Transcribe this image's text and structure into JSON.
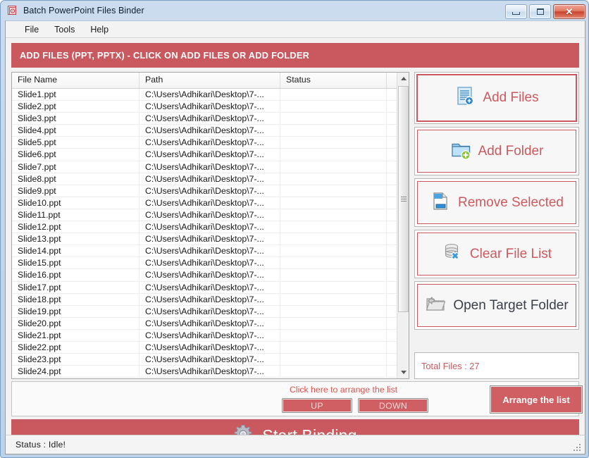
{
  "window": {
    "title": "Batch PowerPoint Files Binder",
    "icon": "app-document-icon",
    "controls": {
      "minimize": "minimize-icon",
      "maximize": "maximize-icon",
      "close": "✕"
    }
  },
  "menu": {
    "items": [
      {
        "label": "File"
      },
      {
        "label": "Tools"
      },
      {
        "label": "Help"
      }
    ]
  },
  "banner": {
    "text": "ADD FILES (PPT, PPTX) - CLICK ON ADD FILES OR ADD FOLDER",
    "background": "#c9585f",
    "color": "#ffffff"
  },
  "file_list": {
    "columns": [
      {
        "label": "File Name"
      },
      {
        "label": "Path"
      },
      {
        "label": "Status"
      },
      {
        "label": ""
      }
    ],
    "rows": [
      {
        "name": "Slide1.ppt",
        "path": "C:\\Users\\Adhikari\\Desktop\\7-...",
        "status": ""
      },
      {
        "name": "Slide2.ppt",
        "path": "C:\\Users\\Adhikari\\Desktop\\7-...",
        "status": ""
      },
      {
        "name": "Slide3.ppt",
        "path": "C:\\Users\\Adhikari\\Desktop\\7-...",
        "status": ""
      },
      {
        "name": "Slide4.ppt",
        "path": "C:\\Users\\Adhikari\\Desktop\\7-...",
        "status": ""
      },
      {
        "name": "Slide5.ppt",
        "path": "C:\\Users\\Adhikari\\Desktop\\7-...",
        "status": ""
      },
      {
        "name": "Slide6.ppt",
        "path": "C:\\Users\\Adhikari\\Desktop\\7-...",
        "status": ""
      },
      {
        "name": "Slide7.ppt",
        "path": "C:\\Users\\Adhikari\\Desktop\\7-...",
        "status": ""
      },
      {
        "name": "Slide8.ppt",
        "path": "C:\\Users\\Adhikari\\Desktop\\7-...",
        "status": ""
      },
      {
        "name": "Slide9.ppt",
        "path": "C:\\Users\\Adhikari\\Desktop\\7-...",
        "status": ""
      },
      {
        "name": "Slide10.ppt",
        "path": "C:\\Users\\Adhikari\\Desktop\\7-...",
        "status": ""
      },
      {
        "name": "Slide11.ppt",
        "path": "C:\\Users\\Adhikari\\Desktop\\7-...",
        "status": ""
      },
      {
        "name": "Slide12.ppt",
        "path": "C:\\Users\\Adhikari\\Desktop\\7-...",
        "status": ""
      },
      {
        "name": "Slide13.ppt",
        "path": "C:\\Users\\Adhikari\\Desktop\\7-...",
        "status": ""
      },
      {
        "name": "Slide14.ppt",
        "path": "C:\\Users\\Adhikari\\Desktop\\7-...",
        "status": ""
      },
      {
        "name": "Slide15.ppt",
        "path": "C:\\Users\\Adhikari\\Desktop\\7-...",
        "status": ""
      },
      {
        "name": "Slide16.ppt",
        "path": "C:\\Users\\Adhikari\\Desktop\\7-...",
        "status": ""
      },
      {
        "name": "Slide17.ppt",
        "path": "C:\\Users\\Adhikari\\Desktop\\7-...",
        "status": ""
      },
      {
        "name": "Slide18.ppt",
        "path": "C:\\Users\\Adhikari\\Desktop\\7-...",
        "status": ""
      },
      {
        "name": "Slide19.ppt",
        "path": "C:\\Users\\Adhikari\\Desktop\\7-...",
        "status": ""
      },
      {
        "name": "Slide20.ppt",
        "path": "C:\\Users\\Adhikari\\Desktop\\7-...",
        "status": ""
      },
      {
        "name": "Slide21.ppt",
        "path": "C:\\Users\\Adhikari\\Desktop\\7-...",
        "status": ""
      },
      {
        "name": "Slide22.ppt",
        "path": "C:\\Users\\Adhikari\\Desktop\\7-...",
        "status": ""
      },
      {
        "name": "Slide23.ppt",
        "path": "C:\\Users\\Adhikari\\Desktop\\7-...",
        "status": ""
      },
      {
        "name": "Slide24.ppt",
        "path": "C:\\Users\\Adhikari\\Desktop\\7-...",
        "status": ""
      }
    ]
  },
  "actions": {
    "buttons": [
      {
        "label": "Add Files",
        "icon": "add-files-icon",
        "focused": true
      },
      {
        "label": "Add Folder",
        "icon": "add-folder-icon",
        "focused": false
      },
      {
        "label": "Remove Selected",
        "icon": "remove-selected-icon",
        "focused": false
      },
      {
        "label": "Clear File List",
        "icon": "clear-file-list-icon",
        "focused": false
      },
      {
        "label": "Open Target Folder",
        "icon": "open-target-folder-icon",
        "focused": false
      }
    ],
    "total_files_label": "Total Files : 27"
  },
  "arrange": {
    "hint": "Click here to arrange the list",
    "up_label": "UP",
    "down_label": "DOWN",
    "arrange_button_label": "Arrange the list"
  },
  "start": {
    "label": "Start Binding",
    "icon": "gear-icon"
  },
  "status": {
    "text": "Status  :  Idle!"
  },
  "colors": {
    "accent_red": "#c9585f",
    "button_red": "#cf5f62",
    "label_red": "#cb5a5f",
    "dark_text": "#3a3f4a"
  }
}
